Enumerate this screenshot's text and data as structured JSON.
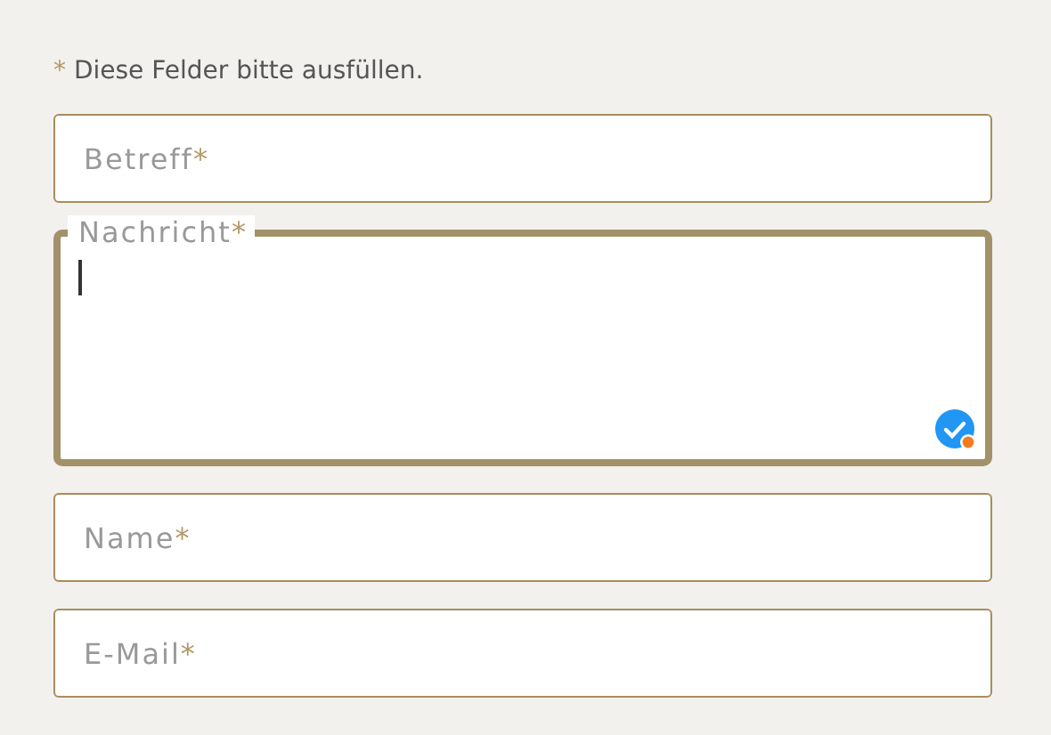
{
  "note": {
    "mark": "*",
    "text": "Diese Felder bitte ausfüllen."
  },
  "fields": [
    {
      "kind": "input",
      "label": "Betreff",
      "mark": "*",
      "focused": false
    },
    {
      "kind": "textarea",
      "label": "Nachricht",
      "mark": "*",
      "focused": true
    },
    {
      "kind": "input",
      "label": "Name",
      "mark": "*",
      "focused": false
    },
    {
      "kind": "input",
      "label": "E-Mail",
      "mark": "*",
      "focused": false
    }
  ]
}
